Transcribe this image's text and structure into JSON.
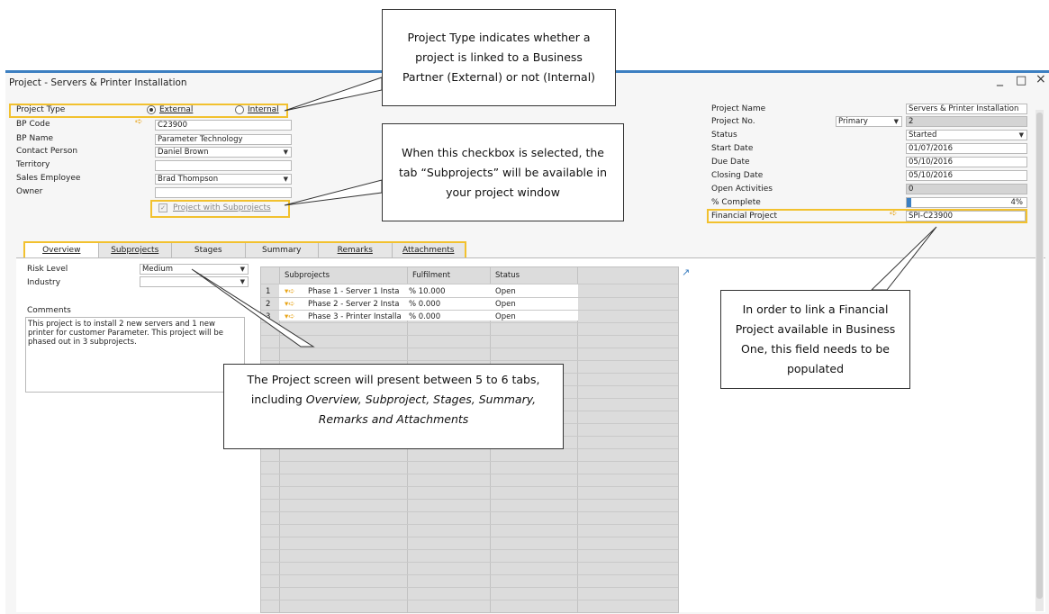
{
  "window": {
    "title": "Project - Servers & Printer Installation",
    "minimize": "_",
    "maximize": "□",
    "close": "×"
  },
  "header_left": {
    "project_type_label": "Project Type",
    "radio_external": "External",
    "radio_internal": "Internal",
    "project_type_selected": "External",
    "bp_code_label": "BP Code",
    "bp_code": "C23900",
    "bp_name_label": "BP Name",
    "bp_name": "Parameter Technology",
    "contact_label": "Contact Person",
    "contact": "Daniel Brown",
    "territory_label": "Territory",
    "territory": "",
    "sales_emp_label": "Sales Employee",
    "sales_emp": "Brad Thompson",
    "owner_label": "Owner",
    "owner": "",
    "subprojects_checkbox": "Project with Subprojects",
    "subprojects_checked": true
  },
  "header_right": {
    "name_label": "Project Name",
    "name": "Servers & Printer Installation",
    "no_label": "Project No.",
    "series": "Primary",
    "no": "2",
    "status_label": "Status",
    "status": "Started",
    "start_label": "Start Date",
    "start": "01/07/2016",
    "due_label": "Due Date",
    "due": "05/10/2016",
    "closing_label": "Closing Date",
    "closing": "05/10/2016",
    "open_act_label": "Open Activities",
    "open_act": "0",
    "complete_label": "% Complete",
    "complete": "4%",
    "fin_label": "Financial Project",
    "fin": "SPI-C23900"
  },
  "tabs": [
    "Overview",
    "Subprojects",
    "Stages",
    "Summary",
    "Remarks",
    "Attachments"
  ],
  "overview": {
    "risk_label": "Risk Level",
    "risk": "Medium",
    "industry_label": "Industry",
    "industry": "",
    "comments_label": "Comments",
    "comments": "This project is to install 2 new servers and 1 new printer for customer Parameter. This project will be phased out in 3 subprojects."
  },
  "grid": {
    "headers": [
      "Subprojects",
      "Fulfilment",
      "Status"
    ],
    "rows": [
      {
        "num": "1",
        "name": "Phase 1 - Server 1 Insta",
        "fulfil": "% 10.000",
        "status": "Open"
      },
      {
        "num": "2",
        "name": "Phase 2 - Server 2 Insta",
        "fulfil": "% 0.000",
        "status": "Open"
      },
      {
        "num": "3",
        "name": "Phase 3 - Printer Installa",
        "fulfil": "% 0.000",
        "status": "Open"
      }
    ]
  },
  "callouts": {
    "project_type": "Project Type indicates whether a project is linked to a Business Partner (External) or not (Internal)",
    "checkbox": "When this checkbox is selected, the tab “Subprojects” will be available in your project window",
    "tabs_prefix": "The Project screen will present between 5 to 6 tabs, including ",
    "tabs_italic": "Overview, Subproject, Stages, Summary, Remarks and Attachments",
    "financial": "In order to link a Financial Project available in Business One, this field needs to be populated"
  },
  "colors": {
    "highlight": "#f2c12e",
    "window_accent": "#3c7fc1",
    "arrow": "#e8a417"
  }
}
